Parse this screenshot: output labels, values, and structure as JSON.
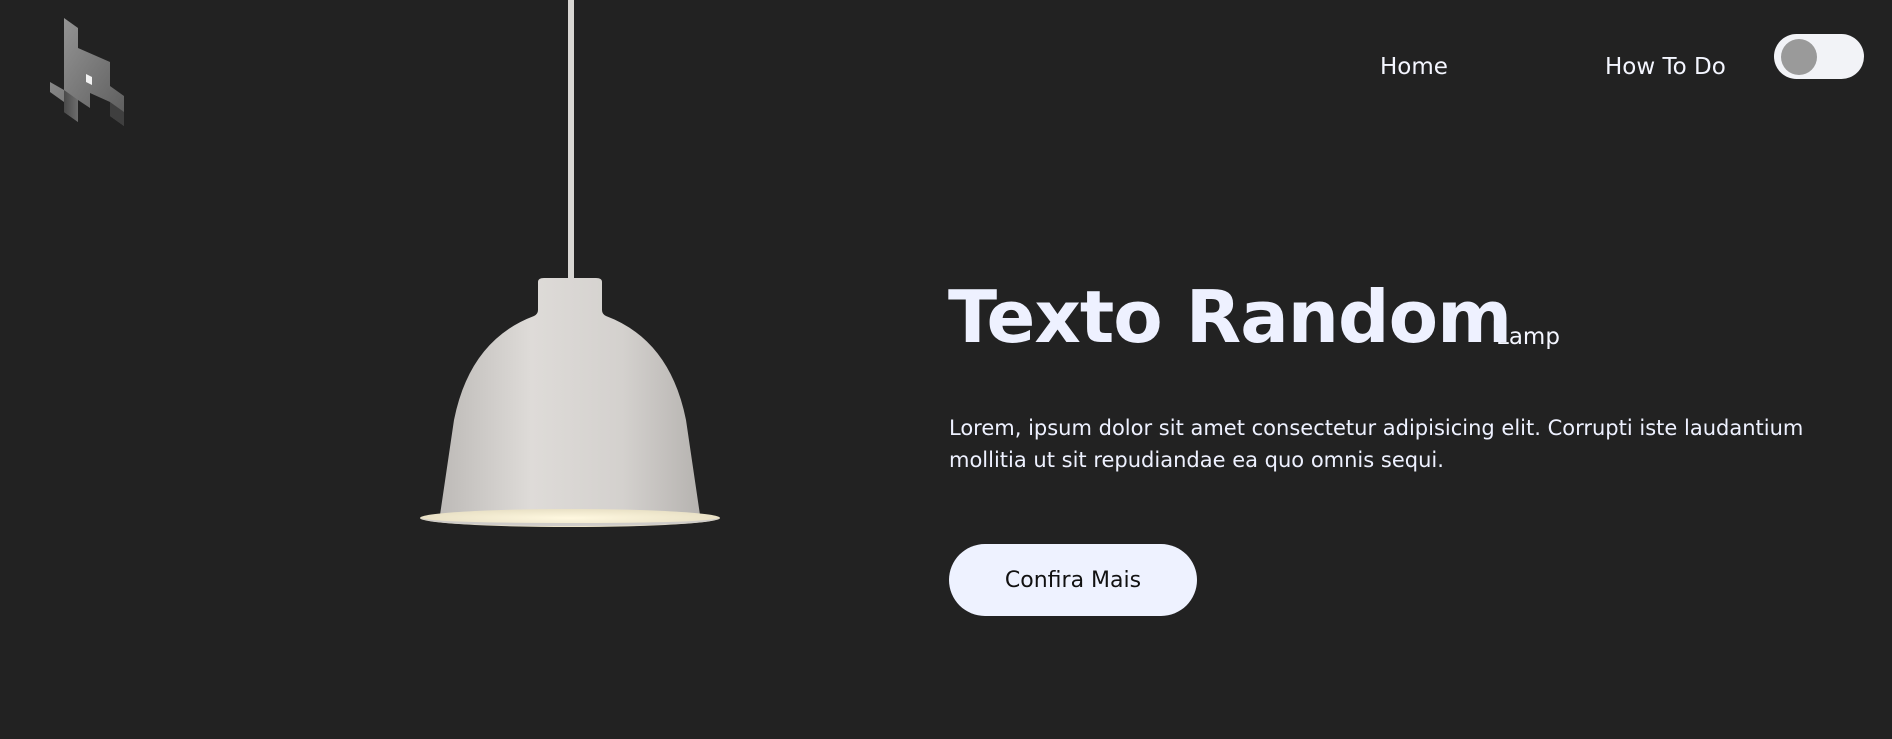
{
  "nav": {
    "items": [
      {
        "label": "Home"
      },
      {
        "label": "Lamp"
      },
      {
        "label": "How To Do"
      }
    ]
  },
  "theme_toggle": {
    "state": "off"
  },
  "hero": {
    "title": "Texto Random",
    "description": "Lorem, ipsum dolor sit amet consectetur adipisicing elit. Corrupti iste laudantium mollitia ut sit repudiandae ea quo omnis sequi.",
    "cta_label": "Confira Mais"
  },
  "colors": {
    "background": "#222222",
    "text": "#eef1ff",
    "button_bg": "#eef2ff",
    "toggle_track": "#f2f3f7",
    "toggle_knob": "#9a9a9a"
  },
  "icons": {
    "logo": "logo-icon",
    "lamp": "pendant-lamp-image"
  }
}
